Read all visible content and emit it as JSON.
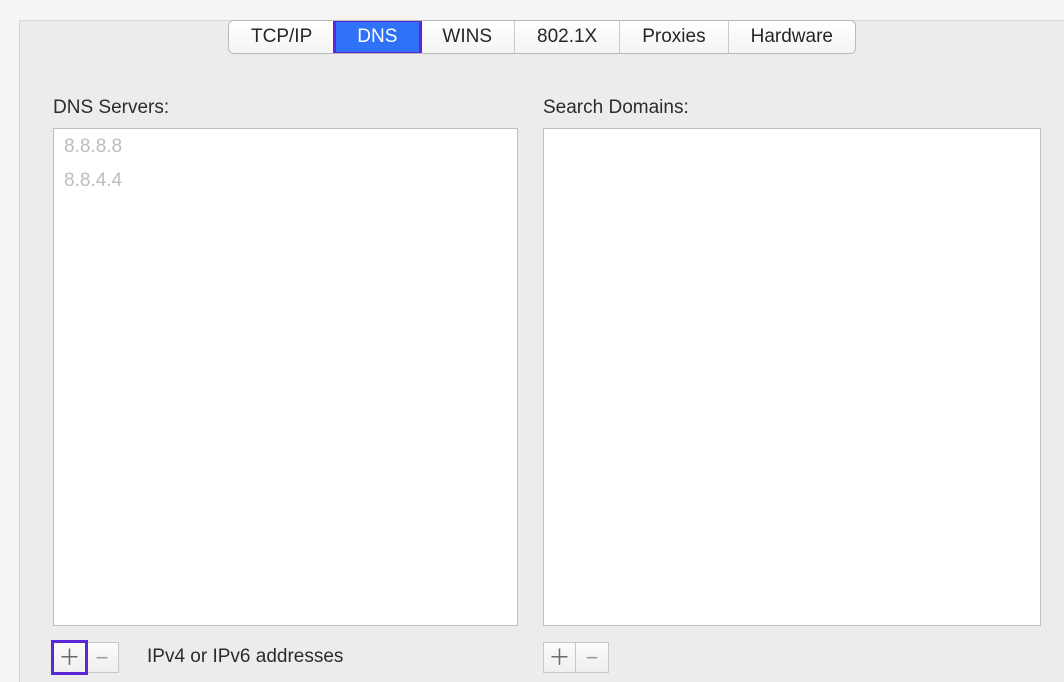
{
  "tabs": {
    "tcpip": {
      "label": "TCP/IP"
    },
    "dns": {
      "label": "DNS"
    },
    "wins": {
      "label": "WINS"
    },
    "dot1x": {
      "label": "802.1X"
    },
    "proxies": {
      "label": "Proxies"
    },
    "hardware": {
      "label": "Hardware"
    }
  },
  "dns": {
    "label": "DNS Servers:",
    "servers": [
      "8.8.8.8",
      "8.8.4.4"
    ],
    "hint": "IPv4 or IPv6 addresses"
  },
  "searchDomains": {
    "label": "Search Domains:"
  },
  "glyphs": {
    "plus": "＋",
    "minus": "−"
  }
}
